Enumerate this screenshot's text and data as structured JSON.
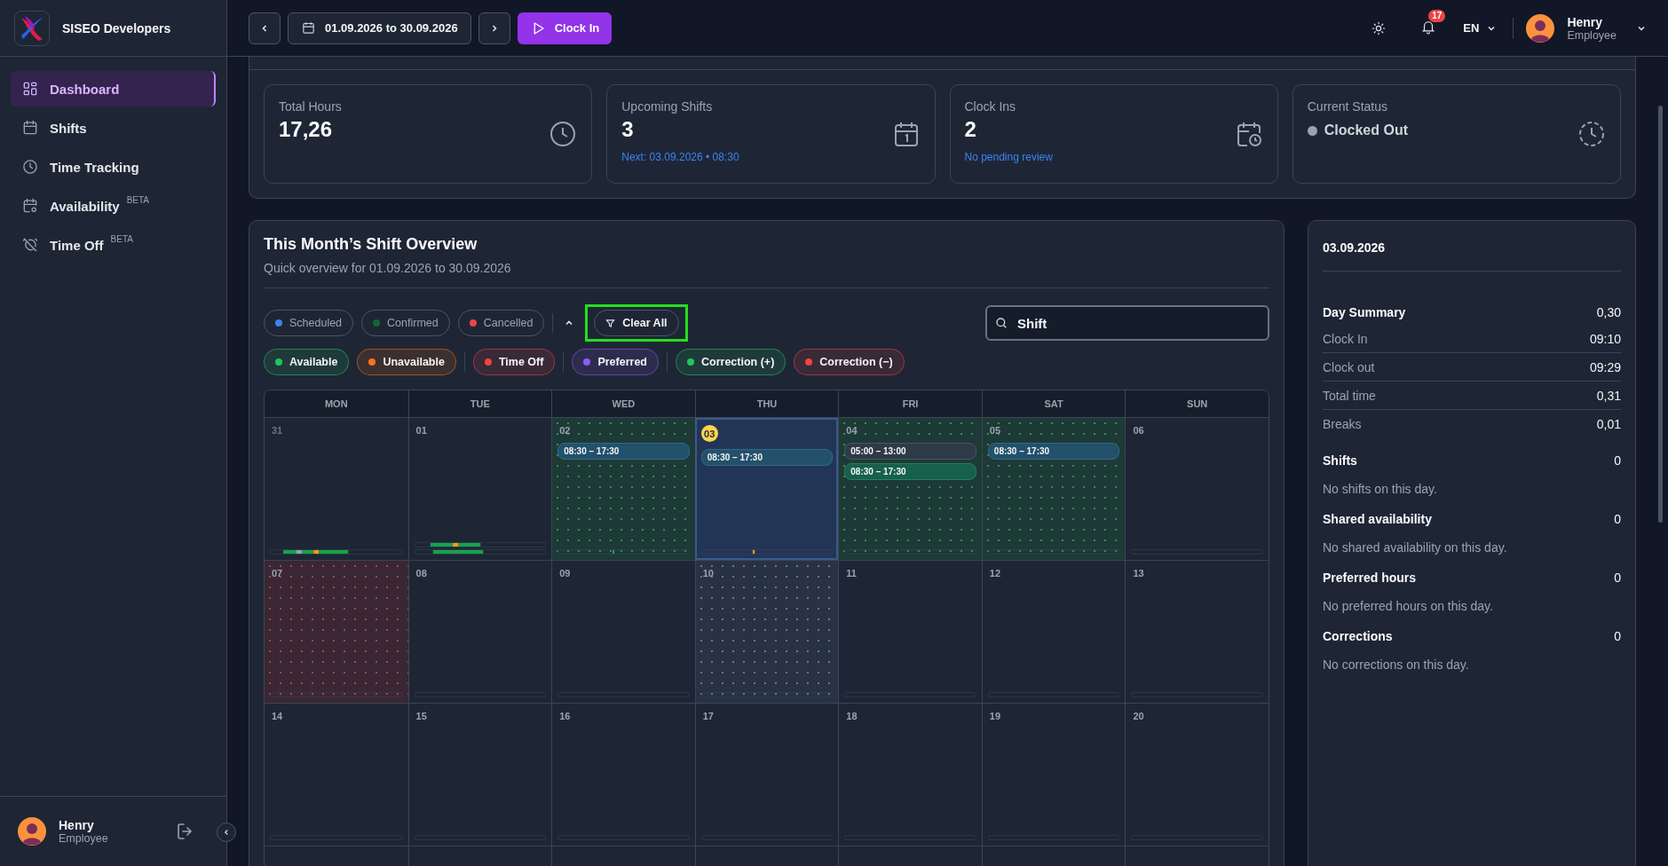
{
  "app": {
    "name": "SISEO Developers"
  },
  "sidebar": {
    "items": [
      {
        "label": "Dashboard",
        "selected": true
      },
      {
        "label": "Shifts",
        "selected": false
      },
      {
        "label": "Time Tracking",
        "selected": false
      },
      {
        "label": "Availability",
        "badge": "BETA",
        "selected": false
      },
      {
        "label": "Time Off",
        "badge": "BETA",
        "selected": false
      }
    ],
    "user": {
      "name": "Henry",
      "role": "Employee"
    }
  },
  "topbar": {
    "date_range": "01.09.2026 to 30.09.2026",
    "clock_in": "Clock In",
    "notifications": "17",
    "language": "EN",
    "user": {
      "name": "Henry",
      "role": "Employee"
    }
  },
  "stats": [
    {
      "label": "Total Hours",
      "value": "17,26",
      "kind": "number"
    },
    {
      "label": "Upcoming Shifts",
      "value": "3",
      "note": "Next: 03.09.2026 • 08:30",
      "kind": "number"
    },
    {
      "label": "Clock Ins",
      "value": "2",
      "note": "No pending review",
      "kind": "number"
    },
    {
      "label": "Current Status",
      "value": "Clocked Out",
      "kind": "status"
    }
  ],
  "overview": {
    "title": "This Month’s Shift Overview",
    "subtitle": "Quick overview for 01.09.2026 to 30.09.2026",
    "status_filters": [
      {
        "label": "Scheduled",
        "color": "#3b82f6",
        "active": false
      },
      {
        "label": "Confirmed",
        "color": "#166534",
        "active": false
      },
      {
        "label": "Cancelled",
        "color": "#ef4444",
        "active": false
      }
    ],
    "clear_all": "Clear All",
    "search": {
      "value": "Shift"
    },
    "type_filters": [
      {
        "label": "Available",
        "color": "#22c55e",
        "active": true
      },
      {
        "label": "Unavailable",
        "color": "#f97316",
        "active": true
      },
      {
        "label": "Time Off",
        "color": "#ef4444",
        "active": true
      },
      {
        "label": "Preferred",
        "color": "#8b5cf6",
        "active": true
      },
      {
        "label": "Correction (+)",
        "color": "#22c55e",
        "active": true
      },
      {
        "label": "Correction (−)",
        "color": "#ef4444",
        "active": true
      }
    ],
    "weekdays": [
      "MON",
      "TUE",
      "WED",
      "THU",
      "FRI",
      "SAT",
      "SUN"
    ],
    "weeks": [
      [
        {
          "day": "31",
          "kind": "plain",
          "muted": true,
          "today": false,
          "selected": false
        },
        {
          "day": "01",
          "kind": "plain",
          "muted": false,
          "today": false,
          "selected": false
        },
        {
          "day": "02",
          "kind": "available",
          "muted": false,
          "today": false,
          "selected": false,
          "shifts": [
            {
              "time": "08:30 – 17:30",
              "kind": "scheduled"
            }
          ]
        },
        {
          "day": "03",
          "kind": "plain",
          "muted": false,
          "today": true,
          "selected": true,
          "shifts": [
            {
              "time": "08:30 – 17:30",
              "kind": "scheduled"
            }
          ]
        },
        {
          "day": "04",
          "kind": "available",
          "muted": false,
          "today": false,
          "selected": false,
          "shifts": [
            {
              "time": "05:00 – 13:00",
              "kind": "draft"
            },
            {
              "time": "08:30 – 17:30",
              "kind": "confirmed"
            }
          ]
        },
        {
          "day": "05",
          "kind": "available",
          "muted": false,
          "today": false,
          "selected": false,
          "shifts": [
            {
              "time": "08:30 – 17:30",
              "kind": "scheduled"
            }
          ]
        },
        {
          "day": "06",
          "kind": "plain",
          "muted": false,
          "today": false,
          "selected": false
        }
      ],
      [
        {
          "day": "07",
          "kind": "timeoff",
          "muted": false,
          "today": false,
          "selected": false
        },
        {
          "day": "08",
          "kind": "plain",
          "muted": false,
          "today": false,
          "selected": false
        },
        {
          "day": "09",
          "kind": "plain",
          "muted": false,
          "today": false,
          "selected": false
        },
        {
          "day": "10",
          "kind": "preferred",
          "muted": false,
          "today": false,
          "selected": false
        },
        {
          "day": "11",
          "kind": "plain",
          "muted": false,
          "today": false,
          "selected": false
        },
        {
          "day": "12",
          "kind": "plain",
          "muted": false,
          "today": false,
          "selected": false
        },
        {
          "day": "13",
          "kind": "plain",
          "muted": false,
          "today": false,
          "selected": false
        }
      ],
      [
        {
          "day": "14",
          "kind": "plain",
          "muted": false,
          "today": false,
          "selected": false
        },
        {
          "day": "15",
          "kind": "plain",
          "muted": false,
          "today": false,
          "selected": false
        },
        {
          "day": "16",
          "kind": "plain",
          "muted": false,
          "today": false,
          "selected": false
        },
        {
          "day": "17",
          "kind": "plain",
          "muted": false,
          "today": false,
          "selected": false
        },
        {
          "day": "18",
          "kind": "plain",
          "muted": false,
          "today": false,
          "selected": false
        },
        {
          "day": "19",
          "kind": "plain",
          "muted": false,
          "today": false,
          "selected": false
        },
        {
          "day": "20",
          "kind": "plain",
          "muted": false,
          "today": false,
          "selected": false
        }
      ]
    ]
  },
  "day_panel": {
    "date": "03.09.2026",
    "summary": {
      "label": "Day Summary",
      "value": "0,30",
      "rows": [
        {
          "label": "Clock In",
          "value": "09:10"
        },
        {
          "label": "Clock out",
          "value": "09:29"
        },
        {
          "label": "Total time",
          "value": "0,31"
        },
        {
          "label": "Breaks",
          "value": "0,01"
        }
      ]
    },
    "sections": [
      {
        "label": "Shifts",
        "count": "0",
        "empty": "No shifts on this day."
      },
      {
        "label": "Shared availability",
        "count": "0",
        "empty": "No shared availability on this day."
      },
      {
        "label": "Preferred hours",
        "count": "0",
        "empty": "No preferred hours on this day."
      },
      {
        "label": "Corrections",
        "count": "0",
        "empty": "No corrections on this day."
      }
    ]
  }
}
